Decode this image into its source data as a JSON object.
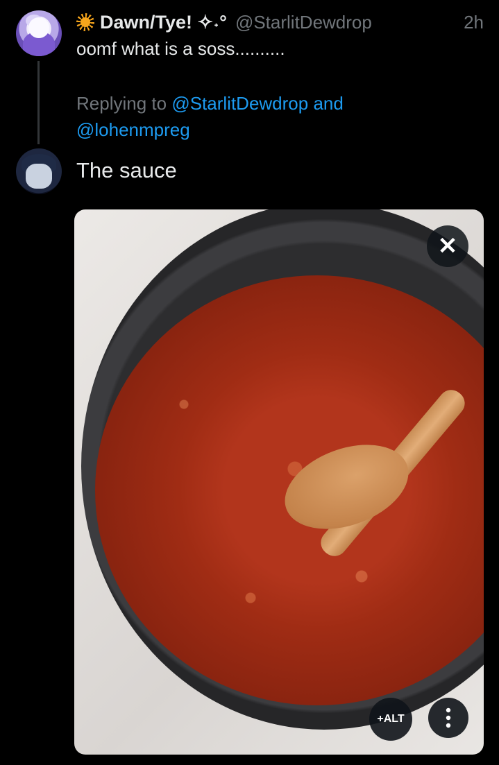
{
  "tweet": {
    "author": {
      "display_name": "Dawn/Tye! ✧˖°",
      "handle": "@StarlitDewdrop",
      "emoji_icon": "sun-icon"
    },
    "time": "2h",
    "text": "oomf what is a soss.........."
  },
  "reply": {
    "replying_prefix": "Replying to",
    "mention1": "@StarlitDewdrop",
    "conjunction": "and",
    "mention2": "@lohenmpreg",
    "text": "The sauce",
    "media": {
      "description_icon": "pasta-sauce-pan-image",
      "close_symbol": "✕",
      "alt_label": "+ALT",
      "more_icon": "more-vertical-icon"
    }
  },
  "colors": {
    "background": "#000000",
    "text": "#e7e9ea",
    "muted": "#71767b",
    "link": "#1d9bf0"
  }
}
